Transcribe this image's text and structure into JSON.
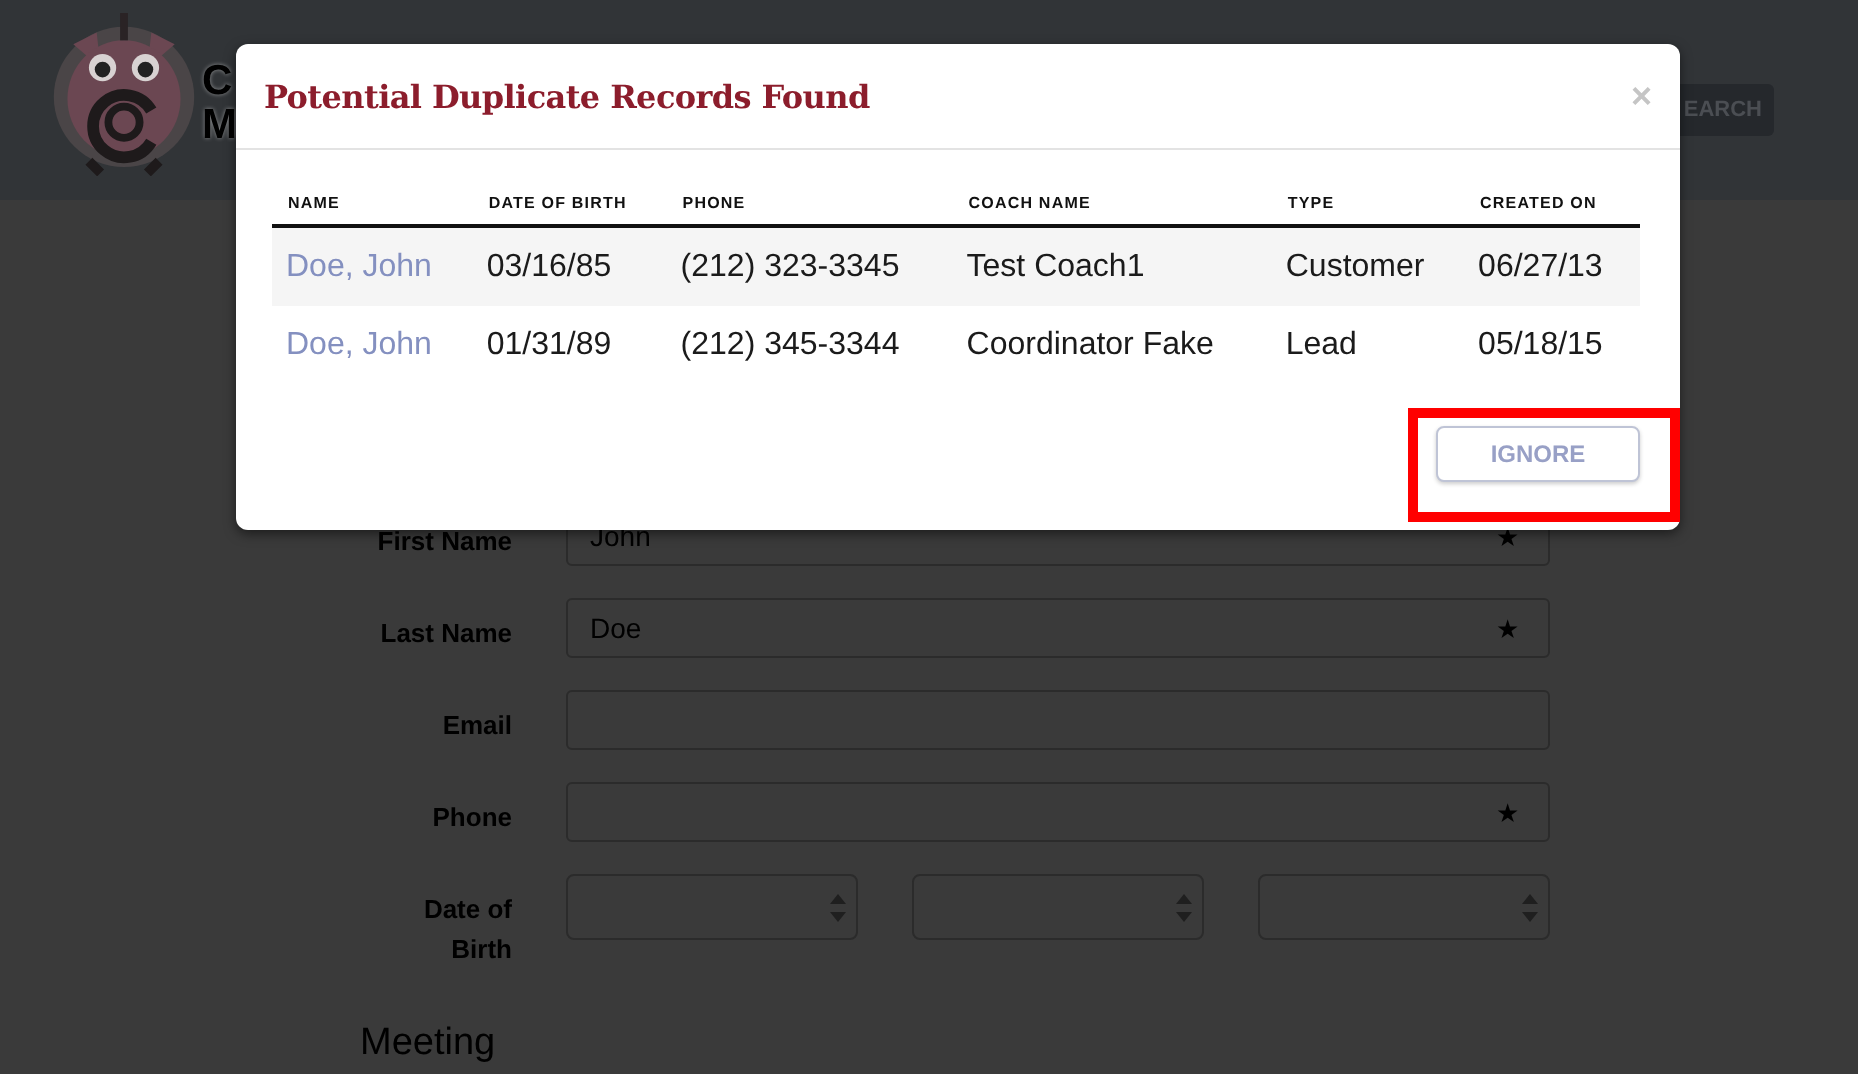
{
  "header": {
    "logo_letters": [
      "C",
      "M"
    ],
    "search_button": "EARCH"
  },
  "form": {
    "rows": [
      {
        "kind": "text",
        "label": "First Name",
        "value": "John",
        "mark": "★"
      },
      {
        "kind": "text",
        "label": "Last Name",
        "value": "Doe",
        "mark": "★"
      },
      {
        "kind": "text",
        "label": "Email"
      },
      {
        "kind": "text",
        "label": "Phone",
        "mark": "★"
      },
      {
        "kind": "date",
        "label": "Date of Birth"
      }
    ],
    "section_title": "Meeting"
  },
  "dialog": {
    "title": "Potential Duplicate Records Found",
    "close": "×",
    "table": {
      "columns": [
        "NAME",
        "DATE OF BIRTH",
        "PHONE",
        "COACH NAME",
        "TYPE",
        "CREATED ON"
      ],
      "rows": [
        {
          "cells": [
            "Doe, John",
            "03/16/85",
            "(212) 323-3345",
            "Test Coach1",
            "Customer",
            "06/27/13"
          ]
        },
        {
          "cells": [
            "Doe, John",
            "01/31/89",
            "(212) 345-3344",
            "Coordinator Fake",
            "Lead",
            "05/18/15"
          ]
        }
      ]
    },
    "button": "IGNORE",
    "highlighted": true
  }
}
